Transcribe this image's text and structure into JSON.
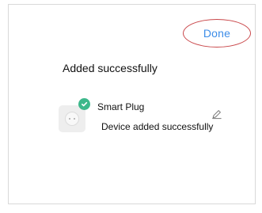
{
  "header": {
    "done_label": "Done"
  },
  "main": {
    "title": "Added successfully",
    "device": {
      "name": "Smart Plug",
      "status": "Device added successfully",
      "thumbnail_icon": "smart-plug-icon",
      "badge_icon": "check-circle-icon",
      "action_icon": "edit-icon"
    }
  },
  "colors": {
    "link_blue": "#3d8de8",
    "highlight_red": "#c9474a",
    "success_green": "#3db88b"
  }
}
